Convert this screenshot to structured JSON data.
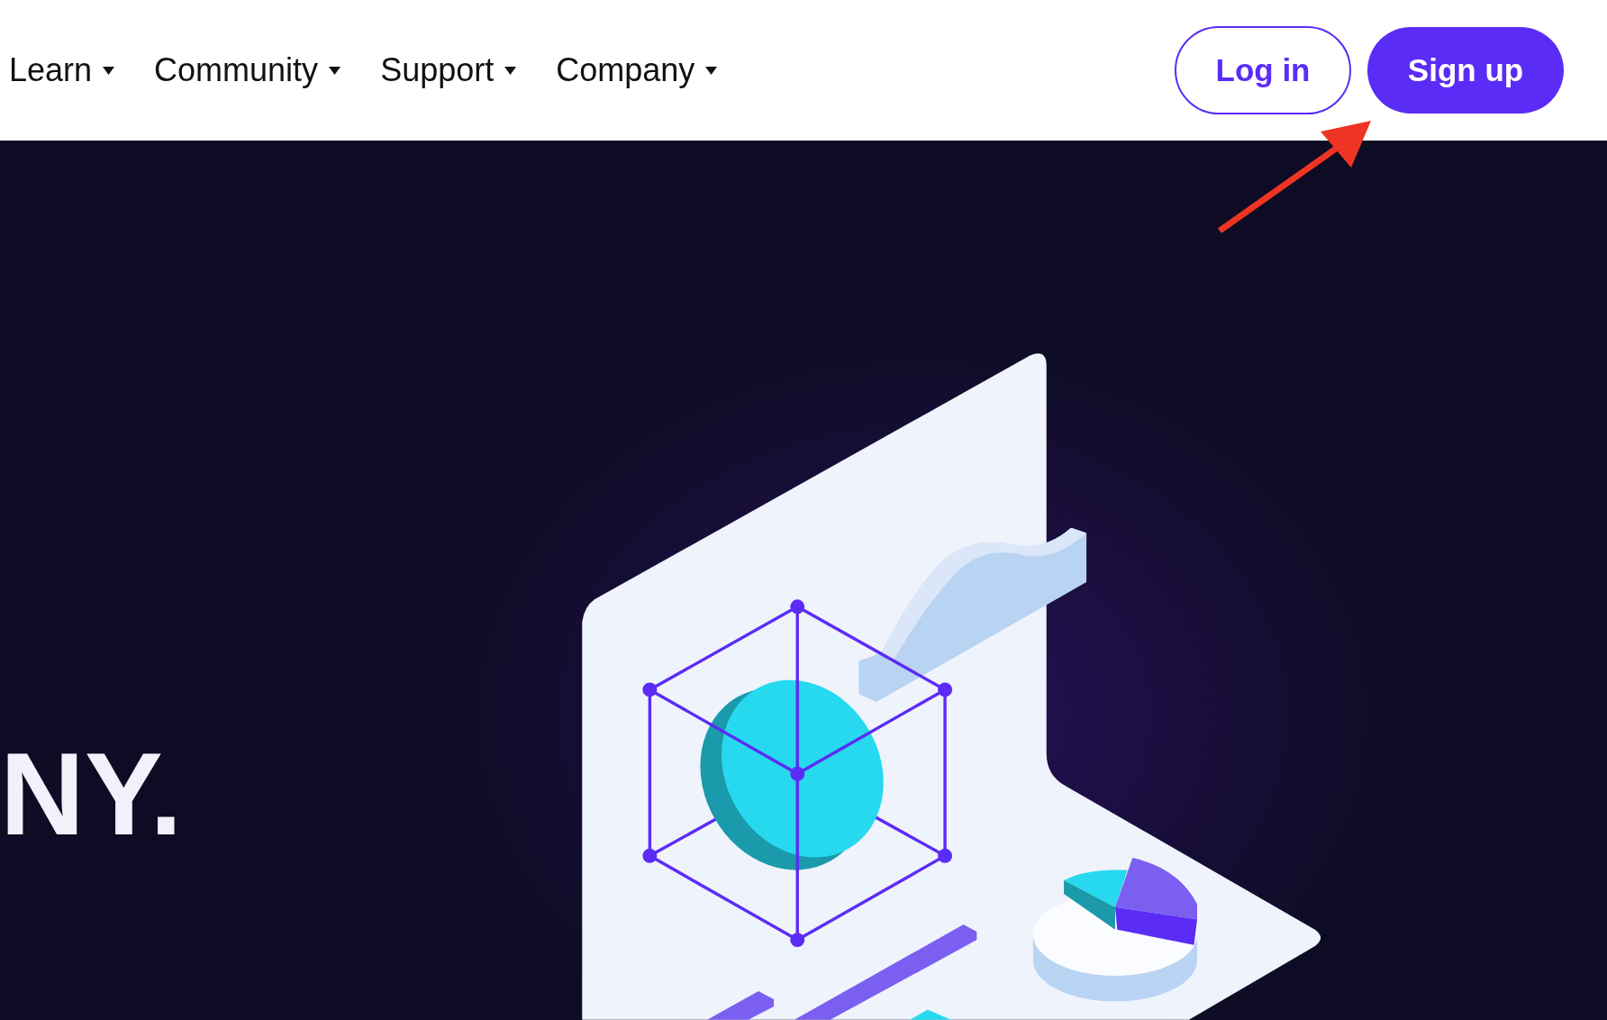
{
  "nav": {
    "items": [
      {
        "label": "Learn"
      },
      {
        "label": "Community"
      },
      {
        "label": "Support"
      },
      {
        "label": "Company"
      }
    ],
    "login": "Log in",
    "signup": "Sign up"
  },
  "hero": {
    "title": "NY."
  }
}
